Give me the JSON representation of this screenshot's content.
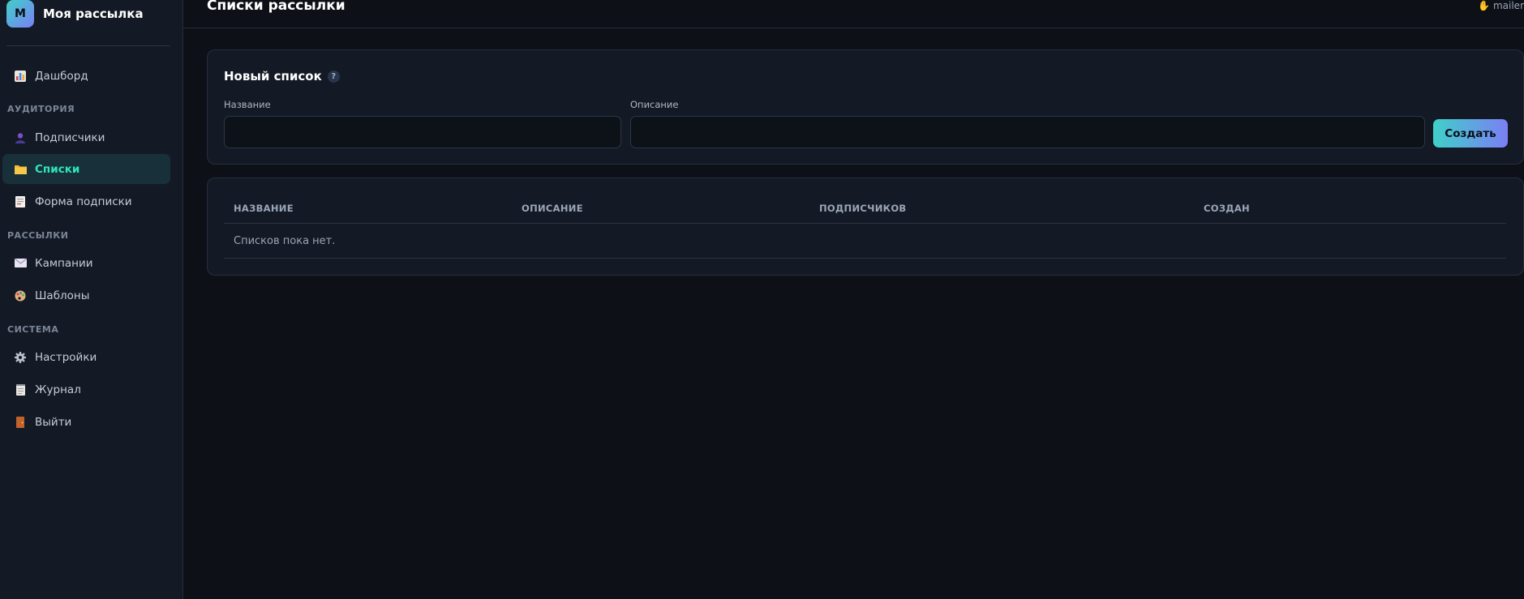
{
  "brand": {
    "logo_letter": "М",
    "name": "Моя рассылка"
  },
  "sidebar": {
    "items": [
      {
        "label": "Дашборд",
        "icon": "bar-chart-icon"
      },
      {
        "section": "АУДИТОРИЯ"
      },
      {
        "label": "Подписчики",
        "icon": "user-icon"
      },
      {
        "label": "Списки",
        "icon": "folder-icon",
        "active": true
      },
      {
        "label": "Форма подписки",
        "icon": "form-icon"
      },
      {
        "section": "РАССЫЛКИ"
      },
      {
        "label": "Кампании",
        "icon": "envelope-icon"
      },
      {
        "label": "Шаблоны",
        "icon": "palette-icon"
      },
      {
        "section": "СИСТЕМА"
      },
      {
        "label": "Настройки",
        "icon": "gear-icon"
      },
      {
        "label": "Журнал",
        "icon": "notepad-icon"
      },
      {
        "label": "Выйти",
        "icon": "door-icon"
      }
    ]
  },
  "header": {
    "title": "Списки рассылки",
    "user": "mailer",
    "user_icon": "wave-hand-icon"
  },
  "new_list": {
    "title": "Новый список",
    "help": "?",
    "name_label": "Название",
    "name_value": "",
    "description_label": "Описание",
    "description_value": "",
    "create_button": "Создать"
  },
  "table": {
    "columns": [
      "НАЗВАНИЕ",
      "ОПИСАНИЕ",
      "ПОДПИСЧИКОВ",
      "СОЗДАН"
    ],
    "empty_text": "Списков пока нет."
  },
  "colors": {
    "background": "#0d1017",
    "sidebar": "#141a25",
    "accent_start": "#3fd0c9",
    "accent_end": "#7b7ff5",
    "active_text": "#2ee6b8"
  }
}
